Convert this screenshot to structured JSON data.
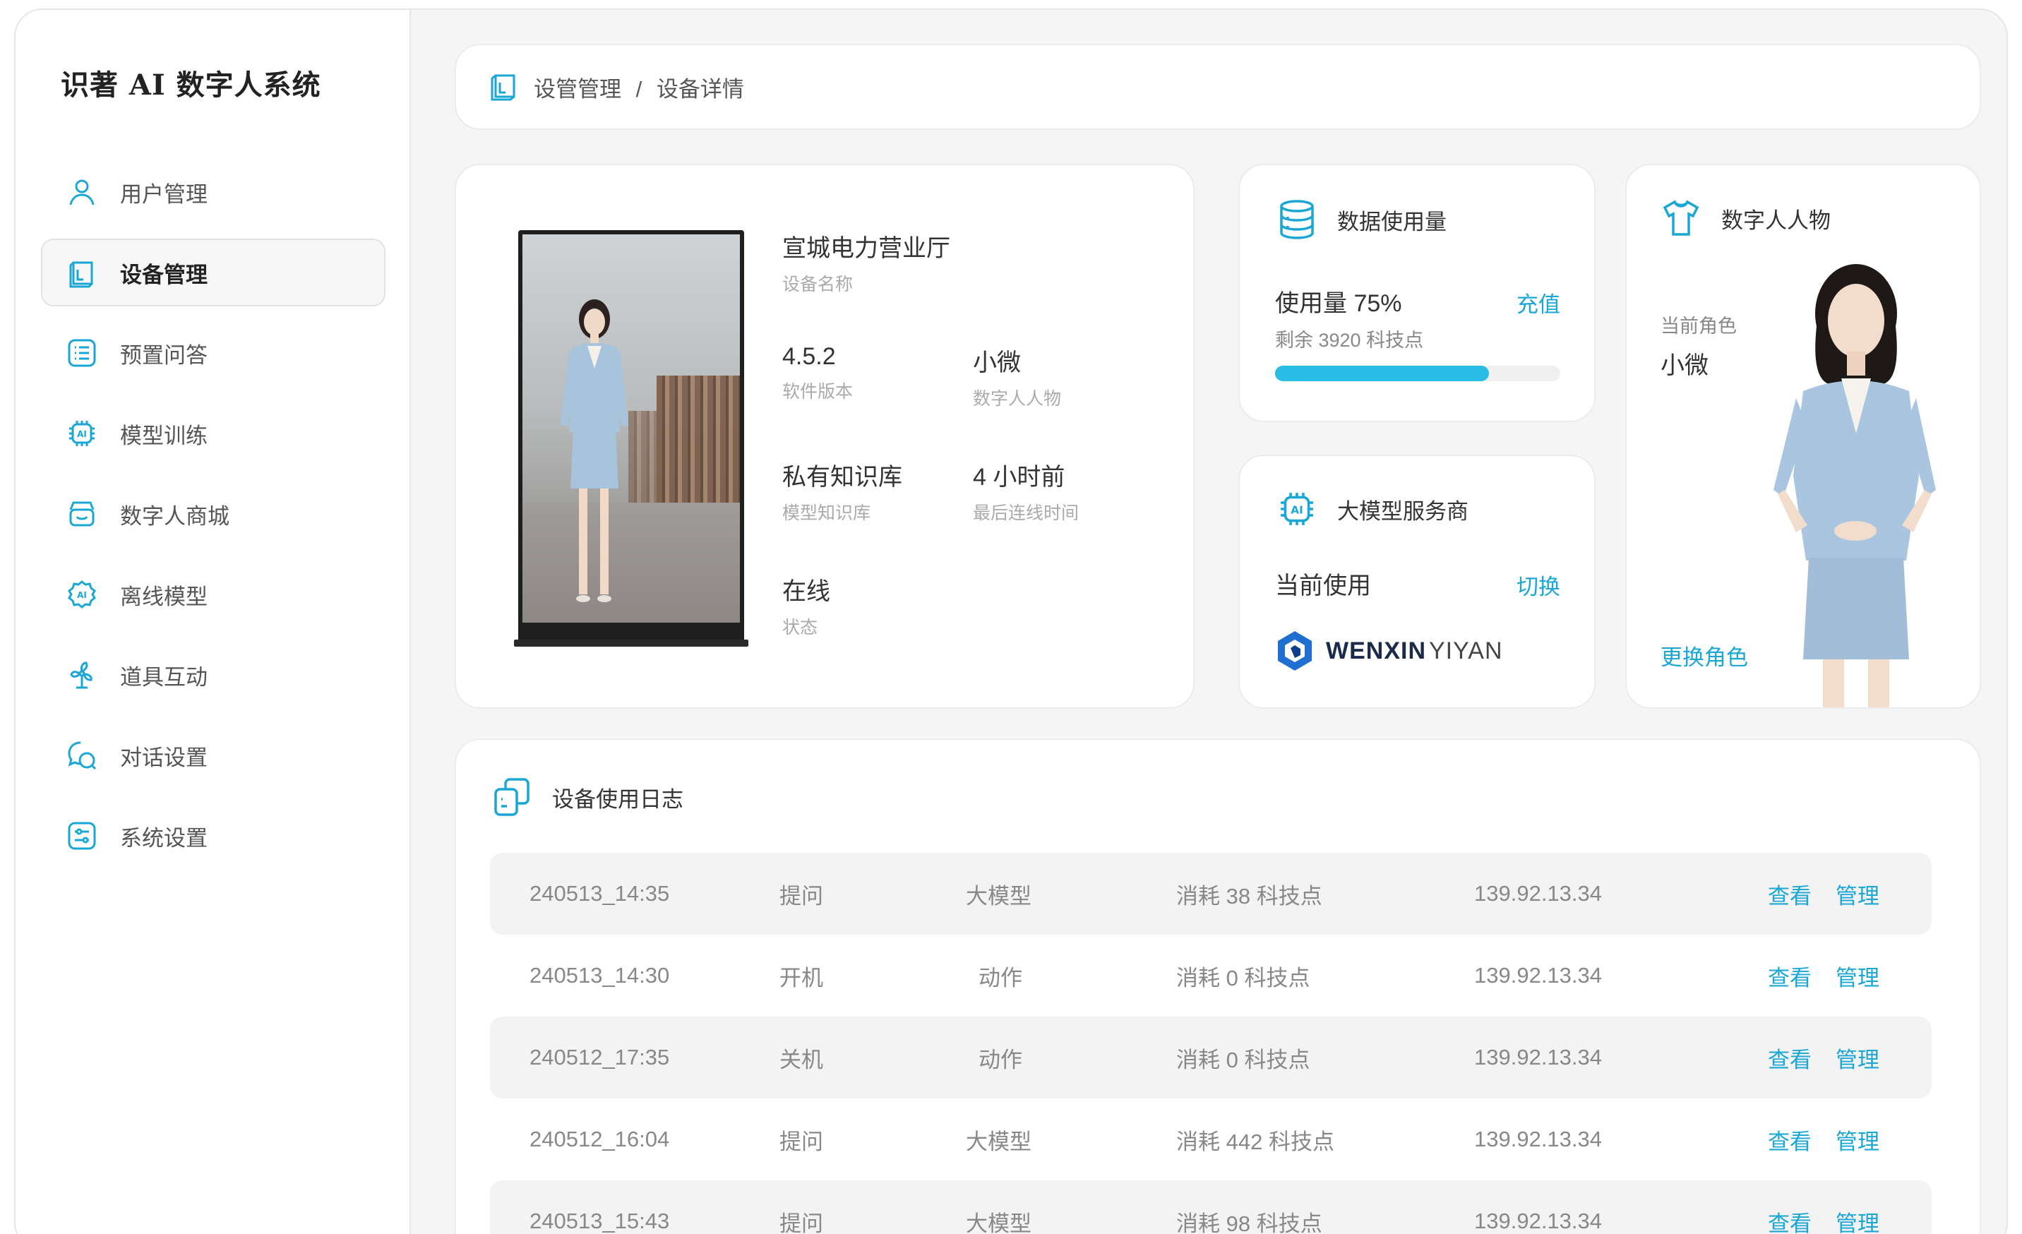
{
  "app": {
    "title": "识著 AI 数字人系统"
  },
  "sidebar": {
    "items": [
      {
        "label": "用户管理",
        "icon": "user-icon"
      },
      {
        "label": "设备管理",
        "icon": "device-icon",
        "active": true
      },
      {
        "label": "预置问答",
        "icon": "list-icon"
      },
      {
        "label": "模型训练",
        "icon": "ai-chip-icon"
      },
      {
        "label": "数字人商城",
        "icon": "store-icon"
      },
      {
        "label": "离线模型",
        "icon": "ai-gear-icon"
      },
      {
        "label": "道具互动",
        "icon": "fan-icon"
      },
      {
        "label": "对话设置",
        "icon": "chat-icon"
      },
      {
        "label": "系统设置",
        "icon": "settings-icon"
      }
    ]
  },
  "breadcrumb": {
    "section": "设管管理",
    "separator": "/",
    "page": "设备详情"
  },
  "device": {
    "name": "宣城电力营业厅",
    "name_label": "设备名称",
    "version": "4.5.2",
    "version_label": "软件版本",
    "persona": "小微",
    "persona_label": "数字人人物",
    "kb": "私有知识库",
    "kb_label": "模型知识库",
    "last_online": "4 小时前",
    "last_online_label": "最后连线时间",
    "status": "在线",
    "status_label": "状态"
  },
  "usage": {
    "title": "数据使用量",
    "usage_text": "使用量 75%",
    "percent": 75,
    "remaining": "剩余 3920 科技点",
    "recharge": "充值"
  },
  "provider": {
    "title": "大模型服务商",
    "current_label": "当前使用",
    "switch": "切换",
    "brand_bold": "WENXIN",
    "brand_light": "YIYAN"
  },
  "persona": {
    "title": "数字人人物",
    "current_label": "当前角色",
    "current_value": "小微",
    "change": "更换角色"
  },
  "log": {
    "title": "设备使用日志",
    "rows": [
      {
        "time": "240513_14:35",
        "type": "提问",
        "source": "大模型",
        "cost": "消耗 38 科技点",
        "ip": "139.92.13.34"
      },
      {
        "time": "240513_14:30",
        "type": "开机",
        "source": "动作",
        "cost": "消耗 0 科技点",
        "ip": "139.92.13.34"
      },
      {
        "time": "240512_17:35",
        "type": "关机",
        "source": "动作",
        "cost": "消耗 0 科技点",
        "ip": "139.92.13.34"
      },
      {
        "time": "240512_16:04",
        "type": "提问",
        "source": "大模型",
        "cost": "消耗 442 科技点",
        "ip": "139.92.13.34"
      },
      {
        "time": "240513_15:43",
        "type": "提问",
        "source": "大模型",
        "cost": "消耗 98 科技点",
        "ip": "139.92.13.34"
      }
    ],
    "view_label": "查看",
    "manage_label": "管理"
  },
  "colors": {
    "accent": "#1aa7d6",
    "progress": "#29bde6"
  }
}
